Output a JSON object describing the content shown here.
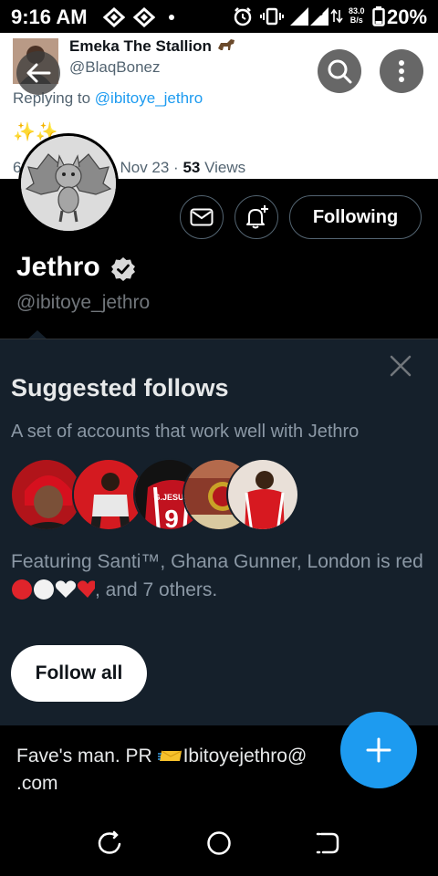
{
  "status_bar": {
    "time": "9:16 AM",
    "network_speed": "83.0",
    "network_unit": "B/s",
    "battery": "20%",
    "signal_type": "3G"
  },
  "tweet": {
    "author_name": "Emeka The Stallion",
    "author_handle": "@BlaqBonez",
    "replying_prefix": "Replying to",
    "replying_handle": "@ibitoye_jethro",
    "emoji": "✨✨",
    "date_partial": "6",
    "date_partial_2": "Nov 23 · ",
    "views_count": "53",
    "views_label": " Views"
  },
  "profile": {
    "name": "Jethro",
    "handle": "@ibitoye_jethro",
    "following_label": "Following",
    "bio_line1": "Fave's man.   PR  ",
    "bio_email": "Ibitoyejethro@",
    "bio_line2": ".com"
  },
  "suggested": {
    "title": "Suggested follows",
    "subtitle": "A set of accounts that work well with Jethro",
    "featuring_text": "Featuring Santi™, Ghana Gunner, London is red",
    "featuring_tail": ", and 7 others.",
    "follow_all_label": "Follow all",
    "avatar_shirt_text": "G.JESUS",
    "avatar_shirt_number": "9"
  },
  "colors": {
    "accent": "#1d9bf0",
    "card_bg": "#15202b",
    "muted_text": "#8b98a5",
    "arsenal_red": "#d7141a"
  },
  "icons": [
    "back-arrow-icon",
    "search-icon",
    "more-vertical-icon",
    "mail-icon",
    "bell-plus-icon",
    "verified-icon",
    "close-icon",
    "plus-icon",
    "alarm-icon",
    "vibrate-icon",
    "signal-icon",
    "battery-icon",
    "recents-icon",
    "home-icon",
    "back-icon"
  ]
}
